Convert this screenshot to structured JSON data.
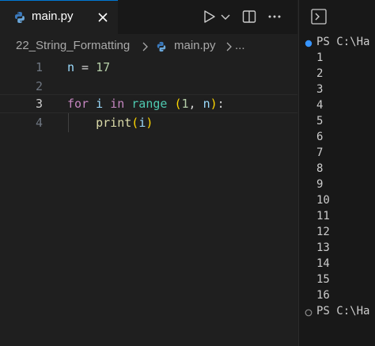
{
  "tab": {
    "filename": "main.py",
    "language_icon": "python-icon",
    "close_icon": "close-icon"
  },
  "actions": {
    "run_icon": "play-icon",
    "run_dropdown_icon": "chevron-down-icon",
    "split_icon": "split-editor-icon",
    "more_icon": "more-icon"
  },
  "breadcrumb": {
    "folder": "22_String_Formatting",
    "file": "main.py",
    "ellipsis": "..."
  },
  "code": {
    "line_numbers": [
      "1",
      "2",
      "3",
      "4"
    ],
    "line1": {
      "var": "n",
      "op": " = ",
      "num": "17"
    },
    "line3": {
      "kw_for": "for",
      "var_i": " i ",
      "kw_in": "in",
      "sp": " ",
      "fn_range": "range",
      "sp2": " ",
      "open": "(",
      "num1": "1",
      "comma": ", ",
      "var_n": "n",
      "close": ")",
      "colon": ":"
    },
    "line4": {
      "indent": "    ",
      "fn_print": "print",
      "open": "(",
      "var_i": "i",
      "close": ")"
    }
  },
  "terminal": {
    "icon": "terminal-icon",
    "prompt_first": "PS C:\\Ha",
    "outputs": [
      "1",
      "2",
      "3",
      "4",
      "5",
      "6",
      "7",
      "8",
      "9",
      "10",
      "11",
      "12",
      "13",
      "14",
      "15",
      "16"
    ],
    "prompt_last": "PS C:\\Ha",
    "colors": {
      "success_dot": "#3794ff",
      "idle_dot": "#8b8b8b"
    }
  },
  "theme": {
    "accent": "#0078d4",
    "editor_bg": "#1f1f1f",
    "panel_bg": "#181818"
  }
}
